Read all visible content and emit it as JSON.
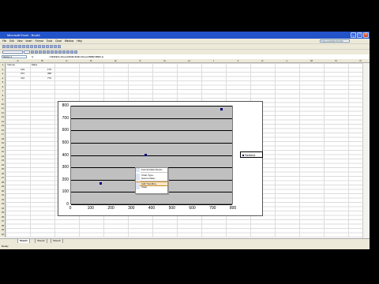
{
  "window": {
    "title": "Microsoft Excel - Book1"
  },
  "menu": [
    "File",
    "Edit",
    "View",
    "Insert",
    "Format",
    "Tools",
    "Chart",
    "Window",
    "Help"
  ],
  "help_box": {
    "placeholder": "Type a question for help"
  },
  "formula_bar": {
    "name_box": "Series 1",
    "formula": "=SERIES(,Sheet1!$A$2:$A$4,Sheet1!$B$2:$B$4,1)"
  },
  "columns": [
    "A",
    "B",
    "C",
    "D",
    "E",
    "F",
    "G",
    "H",
    "I",
    "J",
    "K",
    "L",
    "M",
    "N",
    "O"
  ],
  "rows": [
    "1",
    "2",
    "3",
    "4",
    "5",
    "6",
    "7",
    "8",
    "9",
    "10",
    "11",
    "12",
    "13",
    "14",
    "15",
    "16",
    "17",
    "18",
    "19",
    "20",
    "21",
    "22",
    "23",
    "24",
    "25",
    "26",
    "27",
    "28",
    "29",
    "30",
    "31",
    "32",
    "33",
    "34",
    "35",
    "36",
    "37",
    "38",
    "39",
    "40"
  ],
  "cells": {
    "a1": "Volume",
    "b1": "Mass",
    "a2": "149",
    "b2": "170",
    "a3": "372",
    "b3": "398",
    "a4": "742",
    "b4": "770"
  },
  "chart_data": {
    "type": "scatter",
    "title": "",
    "xlabel": "",
    "ylabel": "",
    "x": [
      149,
      372,
      742
    ],
    "series": [
      {
        "name": "Series1",
        "values": [
          170,
          398,
          770
        ]
      }
    ],
    "xlim": [
      0,
      800
    ],
    "ylim": [
      0,
      800
    ],
    "xticks": [
      "0",
      "100",
      "200",
      "300",
      "400",
      "500",
      "600",
      "700",
      "800"
    ],
    "yticks": [
      "0",
      "100",
      "200",
      "300",
      "400",
      "500",
      "600",
      "700",
      "800"
    ],
    "grid": "horizontal",
    "legend": "right",
    "colors": {
      "plot_area": "#c0c0c0",
      "marker": "#000080"
    }
  },
  "context_menu": {
    "items": [
      "Format Data Series...",
      "Chart Type...",
      "Source Data...",
      "Add Trendline...",
      "Clear"
    ]
  },
  "sheet_tabs": [
    "Sheet1",
    "Sheet2",
    "Sheet3"
  ],
  "status": "Ready"
}
